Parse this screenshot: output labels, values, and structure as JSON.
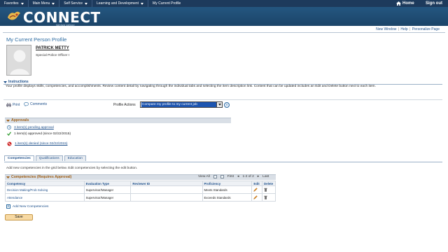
{
  "topnav": {
    "items": [
      "Favorites",
      "Main Menu",
      "Self Service",
      "Learning and Development",
      "My Current Profile"
    ],
    "home": "Home",
    "signout": "Sign out"
  },
  "header": {
    "brand": "CONNECT",
    "sub": "Maryland Judiciary"
  },
  "util": {
    "new_window": "New Window",
    "help": "Help",
    "personalize": "Personalize Page"
  },
  "page": {
    "title": "My Current Person Profile"
  },
  "person": {
    "name": "PATRICK METTY",
    "job_title": "Special Police Officer I"
  },
  "instructions": {
    "heading": "Instructions",
    "text": "Your profile displays skills, competencies, and accomplishments. Review content detail by navigating through the individual tabs and selecting the item description link. Content that can be updated includes an Edit and Delete button next to each item."
  },
  "actions": {
    "print": "Print",
    "comments": "Comments",
    "profile_actions_label": "Profile Actions",
    "profile_actions_value": "Compare my profile to my current job"
  },
  "approvals": {
    "heading": "Approvals",
    "pending": "3 item(s) pending approval",
    "approved": "1 item(s) approved (since 02/22/2015)",
    "denied": "1 item(s) denied (since 02/22/2015)"
  },
  "tabs": [
    {
      "label": "Competencies",
      "active": true
    },
    {
      "label": "Qualifications",
      "active": false
    },
    {
      "label": "Education",
      "active": false
    }
  ],
  "grid": {
    "instructions": "Add new competencies in the grid below. Edit competencies by selecting the edit button.",
    "title": "Competencies (Requires Approval)",
    "view_all": "View All",
    "first": "First",
    "range": "1-2 of 2",
    "last": "Last",
    "columns": [
      "Competency",
      "Evaluation Type",
      "Reviewer ID",
      "Proficiency",
      "Edit",
      "Delete"
    ],
    "rows": [
      {
        "competency": "Decision Making/Prob Solving",
        "evaluation_type": "Supervisor/Manager",
        "reviewer_id": "",
        "proficiency": "Meets Standards"
      },
      {
        "competency": "Attendance",
        "evaluation_type": "Supervisor/Manager",
        "reviewer_id": "",
        "proficiency": "Exceeds Standards"
      }
    ],
    "add_label": "Add New Competencies"
  },
  "save_label": "Save",
  "colors": {
    "nav_bg": "#1d3a5c",
    "header_bg": "#245680",
    "link": "#1d4f8a",
    "section_title": "#a06018",
    "save_bg": "#f7d9a3"
  }
}
